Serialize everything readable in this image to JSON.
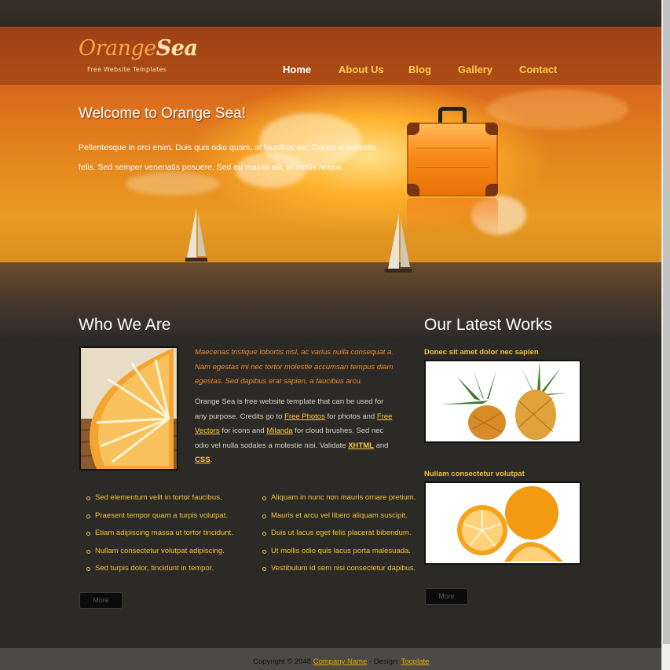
{
  "brand": {
    "name_part1": "Orange",
    "name_part2": "Sea",
    "tagline": "Free Website Templates"
  },
  "nav": [
    {
      "label": "Home",
      "active": true
    },
    {
      "label": "About Us"
    },
    {
      "label": "Blog"
    },
    {
      "label": "Gallery"
    },
    {
      "label": "Contact"
    }
  ],
  "hero": {
    "title": "Welcome to Orange Sea!",
    "text": "Pellentesque in orci enim. Duis quis odio quam, at faucibus est. Donec a molestie felis. Sed semper venenatis posuere. Sed eu massa elit, id mollis neque."
  },
  "about": {
    "heading": "Who We Are",
    "italic_intro": "Maecenas tristique lobortis nisl, ac varius nulla consequat a. Nam egestas mi nec tortor molestie accumsan tempus diam egestas. Sed dapibus erat sapien, a faucibus arcu.",
    "body_1": "Orange Sea is free website template that can be used for any purpose. Credits go to ",
    "link_1": "Free Photos",
    "body_2": " for photos and ",
    "link_2": "Free Vectors",
    "body_3": " for icons and ",
    "link_3": "Milanda",
    "body_4": " for cloud brushes. Sed nec odio vel nulla sodales a molestie nisi. Validate ",
    "link_4": "XHTML",
    "body_5": " and ",
    "link_5": "CSS",
    "body_6": ".",
    "list_left": [
      "Sed elementum velit in tortor faucibus.",
      "Praesent tempor quam a turpis volutpat.",
      "Etiam adipiscing massa ut tortor tincidunt.",
      "Nullam consectetur volutpat adipiscing.",
      "Sed turpis dolor, tincidunt in tempor."
    ],
    "list_right": [
      "Aliquam in nunc non mauris ornare pretium.",
      "Mauris et arcu vel libero aliquam suscipit.",
      "Duis ut lacus eget felis placerat bibendum.",
      "Ut mollis odio quis lacus porta malesuada.",
      "Vestibulum id sem nisi consectetur dapibus."
    ],
    "more_label": "More"
  },
  "works": {
    "heading": "Our Latest Works",
    "items": [
      {
        "title": "Donec sit amet dolor nec sapien"
      },
      {
        "title": "Nullam consectetur volutpat"
      }
    ],
    "more_label": "More"
  },
  "footer": {
    "copyright": "Copyright © 2048 ",
    "company_link": "Company Name",
    "design_text": " - Design: ",
    "design_link": "Tooplate"
  },
  "colors": {
    "accent": "#f0c138",
    "orange": "#f08a28",
    "background": "#2b2a27"
  },
  "icons": {
    "photo": "orange-slice-image",
    "work_1": "pineapple-image",
    "work_2": "orange-fruit-image",
    "hero_object": "suitcase-icon"
  }
}
